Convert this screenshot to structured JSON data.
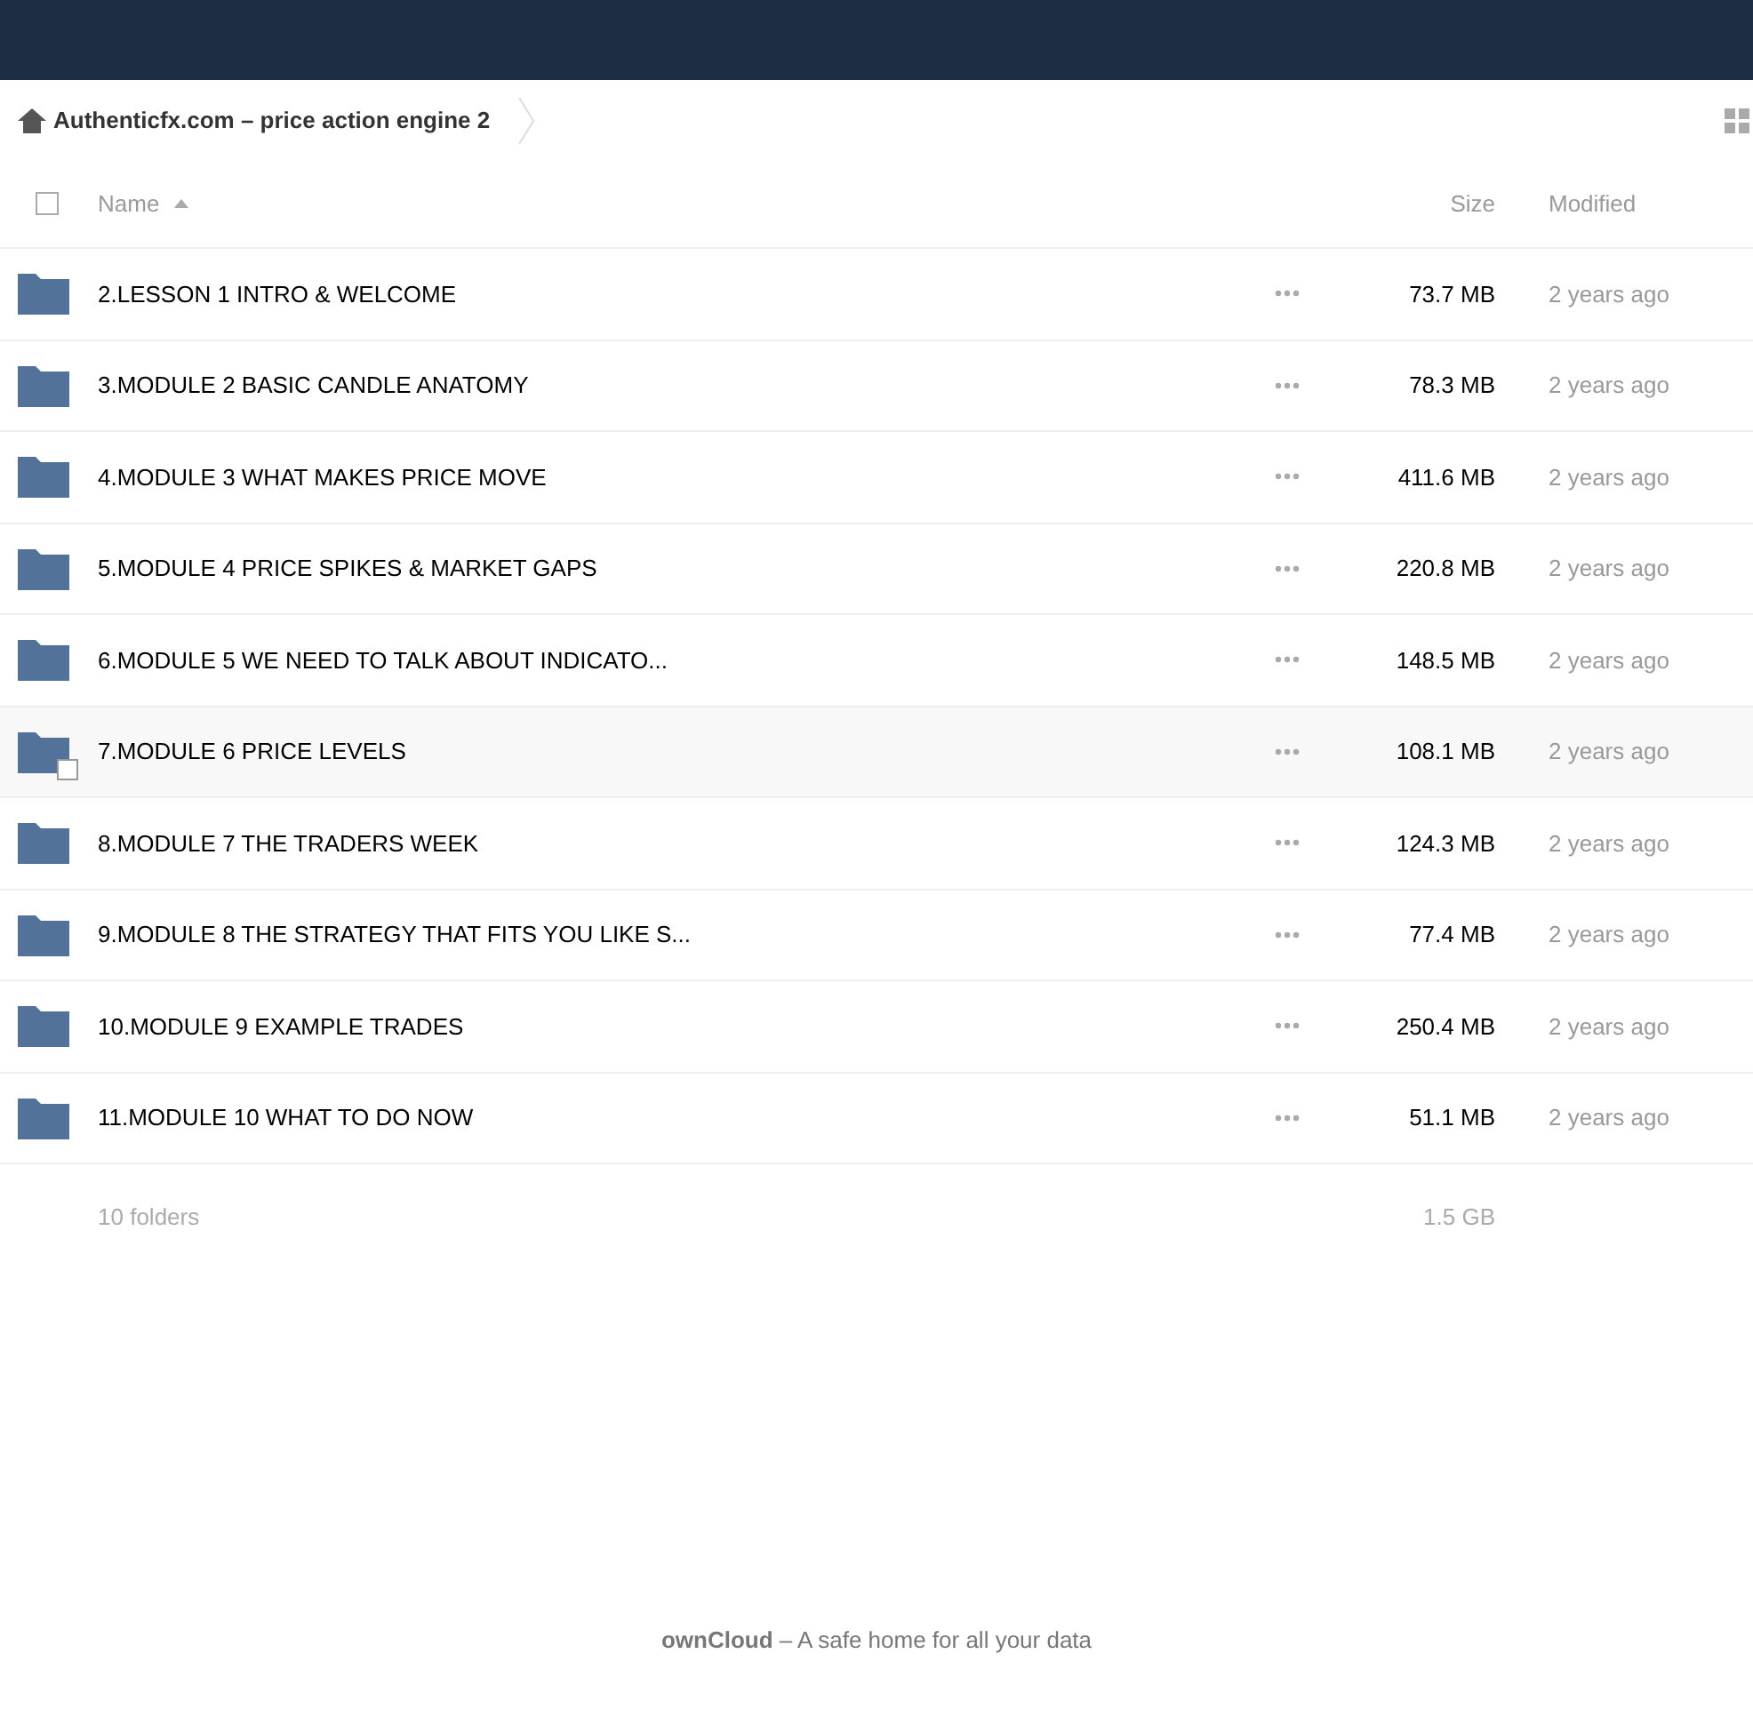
{
  "breadcrumb": {
    "label": "Authenticfx.com – price action engine 2"
  },
  "columns": {
    "name": "Name",
    "size": "Size",
    "modified": "Modified",
    "select_all_checked": false
  },
  "rows": [
    {
      "name": "2.LESSON 1 INTRO & WELCOME",
      "size": "73.7 MB",
      "modified": "2 years ago",
      "hovered": false
    },
    {
      "name": "3.MODULE 2 BASIC CANDLE ANATOMY",
      "size": "78.3 MB",
      "modified": "2 years ago",
      "hovered": false
    },
    {
      "name": "4.MODULE 3 WHAT MAKES PRICE MOVE",
      "size": "411.6 MB",
      "modified": "2 years ago",
      "hovered": false
    },
    {
      "name": "5.MODULE 4 PRICE SPIKES & MARKET GAPS",
      "size": "220.8 MB",
      "modified": "2 years ago",
      "hovered": false
    },
    {
      "name": "6.MODULE 5 WE NEED TO TALK ABOUT INDICATO...",
      "size": "148.5 MB",
      "modified": "2 years ago",
      "hovered": false
    },
    {
      "name": "7.MODULE 6 PRICE LEVELS",
      "size": "108.1 MB",
      "modified": "2 years ago",
      "hovered": true
    },
    {
      "name": "8.MODULE 7 THE TRADERS WEEK",
      "size": "124.3 MB",
      "modified": "2 years ago",
      "hovered": false
    },
    {
      "name": "9.MODULE 8 THE STRATEGY THAT FITS YOU LIKE S...",
      "size": "77.4 MB",
      "modified": "2 years ago",
      "hovered": false
    },
    {
      "name": "10.MODULE 9 EXAMPLE TRADES",
      "size": "250.4 MB",
      "modified": "2 years ago",
      "hovered": false
    },
    {
      "name": "11.MODULE 10 WHAT TO DO NOW",
      "size": "51.1 MB",
      "modified": "2 years ago",
      "hovered": false
    }
  ],
  "summary": {
    "count": "10",
    "label": "folders",
    "size": "1.5 GB"
  },
  "footer": "**ownCloud** – A safe home for all your data"
}
